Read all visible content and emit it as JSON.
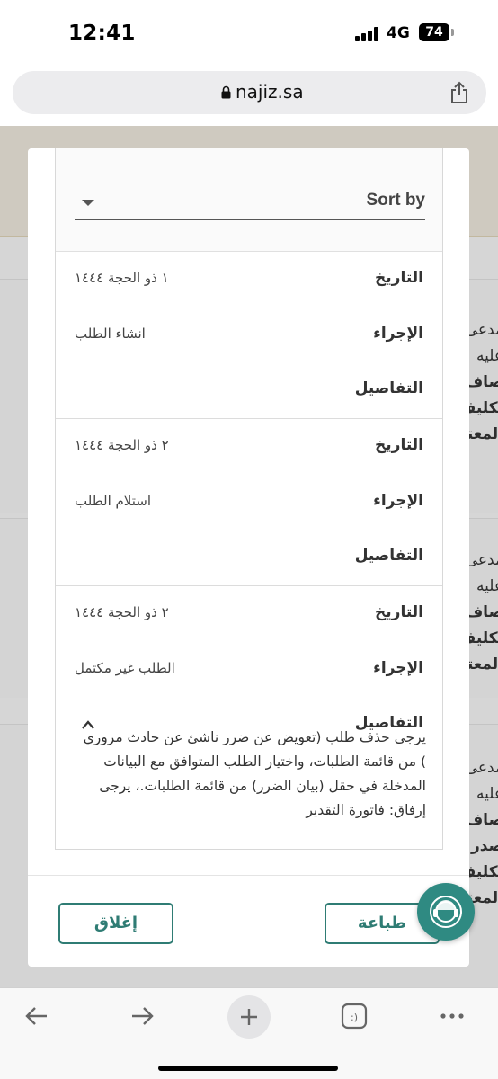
{
  "status_bar": {
    "time": "12:41",
    "network": "4G",
    "battery": "74"
  },
  "browser": {
    "url": "najiz.sa"
  },
  "background_page": {
    "cards": [
      {
        "lines": [
          "مدعى",
          "عليه",
          "صاف",
          "تكليف",
          "المعتزي"
        ]
      },
      {
        "lines": [
          "مدعى",
          "عليه",
          "صاف ب",
          "تكليف",
          "المعتزي"
        ]
      },
      {
        "lines": [
          "مدعى",
          "عليه",
          "صاف",
          "صدر",
          "تكليف",
          "المعتزي"
        ]
      }
    ]
  },
  "modal": {
    "sort_label": "Sort by",
    "entries": [
      {
        "date_label": "التاريخ",
        "date": "١ ذو الحجة ١٤٤٤",
        "action_label": "الإجراء",
        "action": "انشاء الطلب",
        "details_label": "التفاصيل"
      },
      {
        "date_label": "التاريخ",
        "date": "٢ ذو الحجة ١٤٤٤",
        "action_label": "الإجراء",
        "action": "استلام الطلب",
        "details_label": "التفاصيل"
      },
      {
        "date_label": "التاريخ",
        "date": "٢ ذو الحجة ١٤٤٤",
        "action_label": "الإجراء",
        "action": "الطلب غير مكتمل",
        "details_label": "التفاصيل"
      }
    ],
    "details_text": "يرجى حذف طلب (تعويض عن ضرر ناشئ عن حادث مروري ) من قائمة الطلبات، واختيار الطلب المتوافق مع البيانات المدخلة في حقل (بيان الضرر) من قائمة الطلبات.، يرجى إرفاق: فاتورة التقدير",
    "print_label": "طباعة",
    "close_label": "إغلاق"
  },
  "colors": {
    "accent": "#2f7c74",
    "fab": "#2f8a82"
  },
  "icons": [
    "lock-icon",
    "share-icon",
    "chevron-up-icon",
    "sort-caret-icon",
    "support-agent-icon",
    "back-arrow-icon",
    "forward-arrow-icon",
    "new-tab-icon",
    "tabs-icon",
    "more-icon"
  ]
}
